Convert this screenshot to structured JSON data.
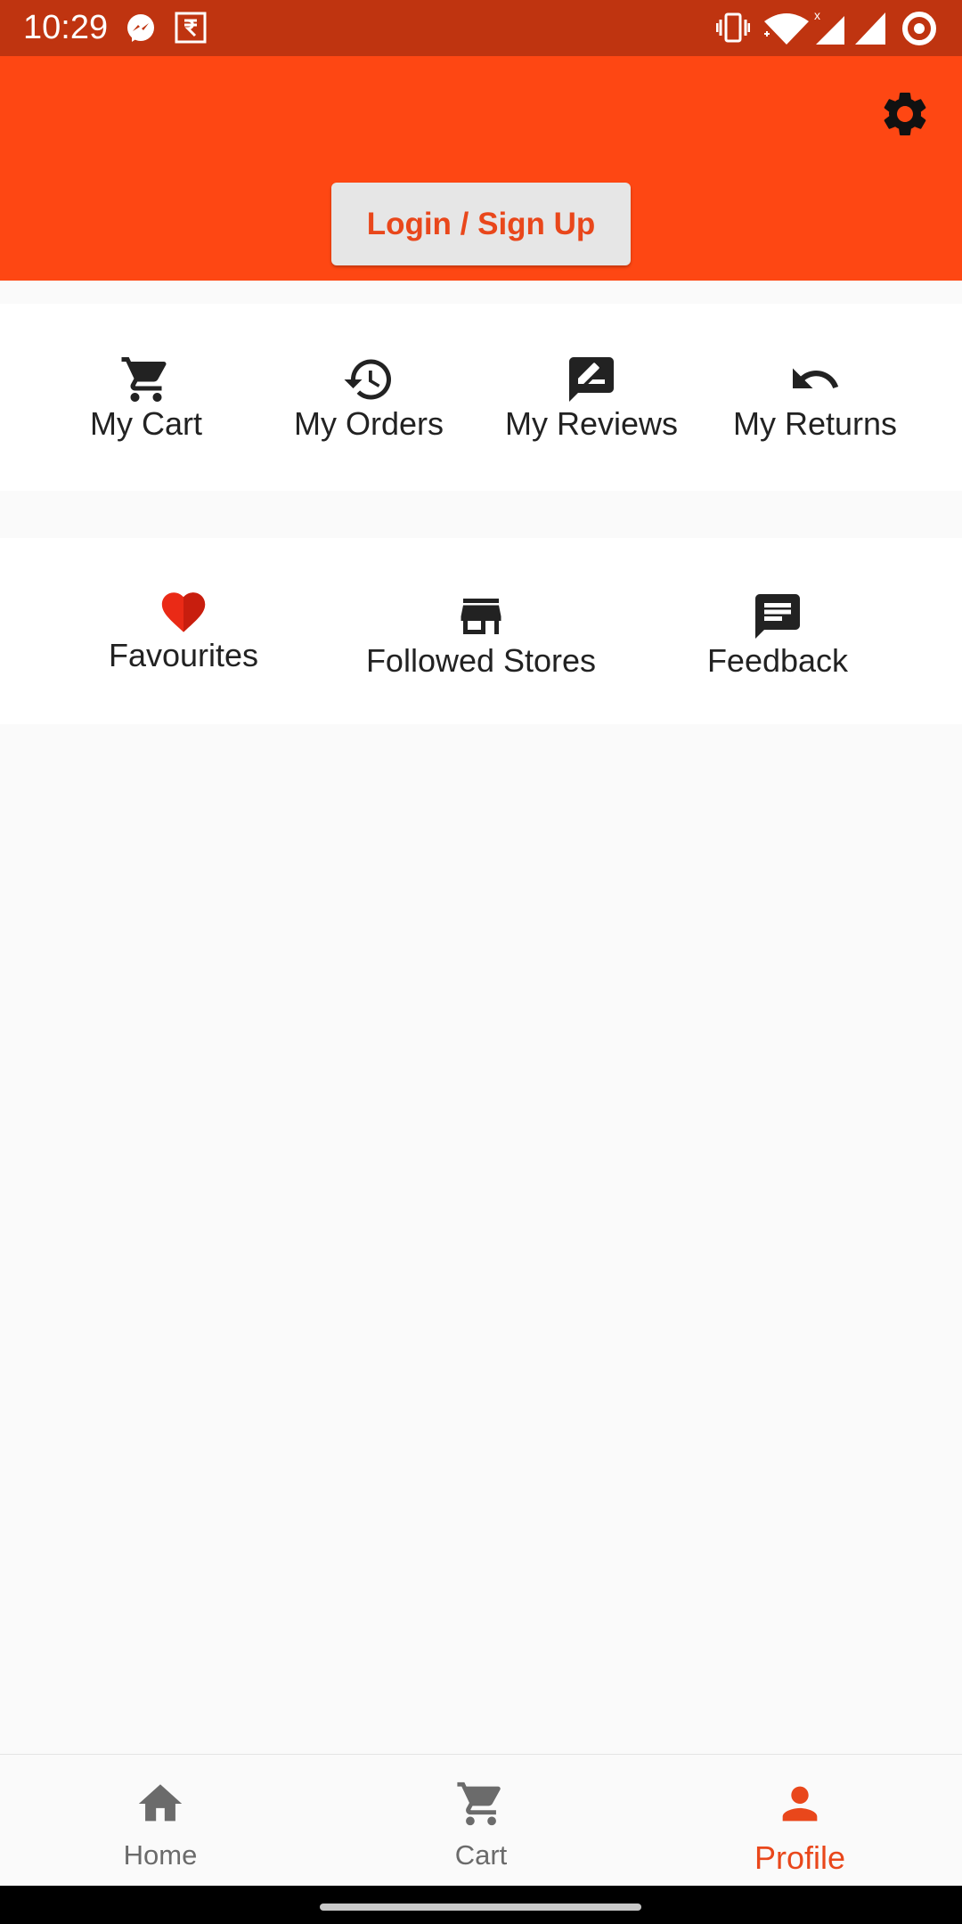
{
  "status_bar": {
    "time": "10:29",
    "left_icons": [
      "messenger-icon",
      "rupee-app-icon"
    ],
    "right_icons": [
      "vibrate-icon",
      "wifi-icon",
      "signal-x-icon",
      "signal-icon",
      "ring-icon"
    ]
  },
  "header": {
    "background": "#fe4713",
    "settings_icon": "gear-icon",
    "login_button": "Login / Sign Up"
  },
  "quick_actions": [
    {
      "label": "My Cart",
      "icon": "cart-icon"
    },
    {
      "label": "My Orders",
      "icon": "history-icon"
    },
    {
      "label": "My Reviews",
      "icon": "rate-review-icon"
    },
    {
      "label": "My Returns",
      "icon": "undo-icon"
    }
  ],
  "secondary_actions": [
    {
      "label": "Favourites",
      "icon": "heart-icon",
      "color": "#ea2a16"
    },
    {
      "label": "Followed Stores",
      "icon": "store-icon"
    },
    {
      "label": "Feedback",
      "icon": "feedback-icon"
    }
  ],
  "bottom_nav": {
    "items": [
      {
        "label": "Home",
        "icon": "home-icon"
      },
      {
        "label": "Cart",
        "icon": "cart-icon"
      },
      {
        "label": "Profile",
        "icon": "person-icon"
      }
    ],
    "active": "Profile",
    "active_color": "#e9471b"
  }
}
